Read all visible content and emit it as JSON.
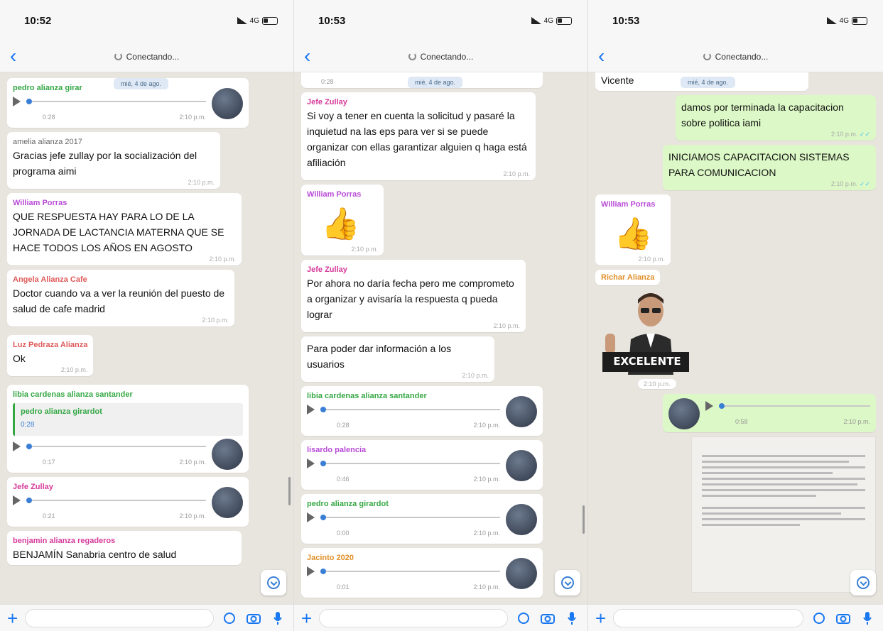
{
  "colors": {
    "ios_blue": "#1877f2",
    "bubble_out": "#dcf8c6",
    "bubble_in": "#ffffff",
    "chat_bg": "#e8e4de"
  },
  "screens": [
    {
      "time": "10:52",
      "network": "4G",
      "title": "Conectando...",
      "date_pill": "mié, 4 de ago.",
      "messages": [
        {
          "sender": "pedro alianza girar",
          "sender_color": "#35a845",
          "voice_duration": "0:28",
          "voice_time": "2:10 p.m."
        },
        {
          "sender": "amelia alianza 2017",
          "sender_color": "#666666",
          "text": "Gracias jefe zullay por la socialización del programa aimi",
          "time": "2:10 p.m."
        },
        {
          "sender": "William Porras",
          "sender_color": "#b84bd6",
          "text": "QUE RESPUESTA HAY PARA LO DE LA JORNADA DE LACTANCIA MATERNA QUE SE HACE TODOS LOS AÑOS EN AGOSTO",
          "time": "2:10 p.m."
        },
        {
          "sender": "Angela Alianza Cafe",
          "sender_color": "#e05a5a",
          "text": "Doctor cuando va a ver la reunión del puesto de salud de cafe madrid",
          "time": "2:10 p.m."
        },
        {
          "sender": "Luz Pedraza Alianza",
          "sender_color": "#e05a5a",
          "text": "Ok",
          "time": "2:10 p.m."
        },
        {
          "sender": "libia cardenas alianza santander",
          "sender_color": "#35a845",
          "quote_sender": "pedro alianza girardot",
          "quote_text": "0:28",
          "voice_duration": "0:17",
          "voice_time": "2:10 p.m."
        },
        {
          "sender": "Jefe Zullay",
          "sender_color": "#d63a9a",
          "voice_duration": "0:21",
          "voice_time": "2:10 p.m."
        },
        {
          "sender": "benjamin alianza regaderos",
          "sender_color": "#d63a9a",
          "text": "BENJAMÍN Sanabria centro de salud"
        }
      ]
    },
    {
      "time": "10:53",
      "network": "4G",
      "title": "Conectando...",
      "date_pill": "mié, 4 de ago.",
      "messages": [
        {
          "voice_duration": "0:28"
        },
        {
          "sender": "Jefe Zullay",
          "sender_color": "#d63a9a",
          "text": "Si voy a tener en cuenta la solicitud y pasaré la inquietud na las eps para ver si se puede organizar con ellas garantizar alguien q haga está afiliación",
          "time": "2:10 p.m."
        },
        {
          "sender": "William Porras",
          "sender_color": "#b84bd6",
          "sticker": "👍",
          "time": "2:10 p.m."
        },
        {
          "sender": "Jefe Zullay",
          "sender_color": "#d63a9a",
          "text": "Por ahora no daría fecha pero me comprometo a organizar y avisaría la respuesta q pueda lograr",
          "time": "2:10 p.m."
        },
        {
          "text": "Para poder dar información a los usuarios",
          "time": "2:10 p.m."
        },
        {
          "sender": "libia cardenas alianza santander",
          "sender_color": "#35a845",
          "voice_duration": "0:28",
          "voice_time": "2:10 p.m."
        },
        {
          "sender": "lisardo palencia",
          "sender_color": "#b84bd6",
          "voice_duration": "0:46",
          "voice_time": "2:10 p.m."
        },
        {
          "sender": "pedro alianza girardot",
          "sender_color": "#35a845",
          "voice_duration": "0:00",
          "voice_time": "2:10 p.m."
        },
        {
          "sender": "Jacinto 2020",
          "sender_color": "#e0902a",
          "voice_duration": "0:01",
          "voice_time": "2:10 p.m."
        }
      ]
    },
    {
      "time": "10:53",
      "network": "4G",
      "title": "Conectando...",
      "date_pill": "mié, 4 de ago.",
      "messages": [
        {
          "text": "Vicente",
          "time": "2:10 p.m."
        },
        {
          "out": true,
          "text": "damos por terminada la capacitacion sobre politica iami",
          "time": "2:10 p.m."
        },
        {
          "out": true,
          "text": "INICIAMOS CAPACITACION SISTEMAS PARA COMUNICACION",
          "time": "2:10 p.m."
        },
        {
          "sender": "William Porras",
          "sender_color": "#b84bd6",
          "sticker": "👍",
          "time": "2:10 p.m."
        },
        {
          "sender": "Richar Alianza",
          "sender_color": "#e0902a",
          "sticker_text": "EXCELENTE",
          "time": "2:10 p.m."
        },
        {
          "out": true,
          "voice_duration": "0:58",
          "voice_time": "2:10 p.m."
        }
      ]
    }
  ]
}
